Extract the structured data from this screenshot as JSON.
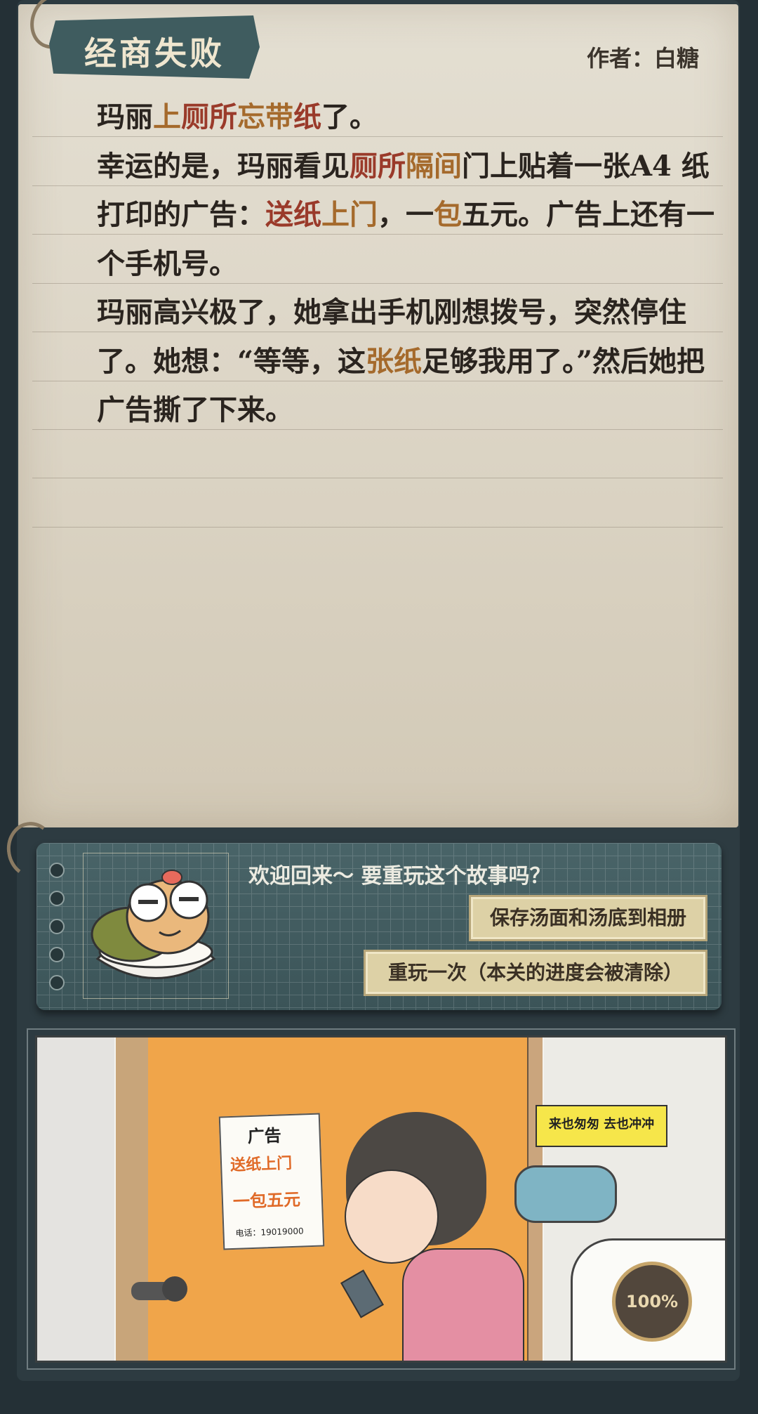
{
  "story": {
    "title": "经商失败",
    "author": "作者：白糖",
    "paragraph1": [
      {
        "text": "玛丽",
        "hl": ""
      },
      {
        "text": "上",
        "hl": "hl-brown"
      },
      {
        "text": "厕所",
        "hl": "hl-red"
      },
      {
        "text": "忘带",
        "hl": "hl-brown"
      },
      {
        "text": "纸",
        "hl": "hl-red"
      },
      {
        "text": "了。",
        "hl": ""
      }
    ],
    "paragraph2": [
      {
        "text": "幸运的是，玛丽看见",
        "hl": ""
      },
      {
        "text": "厕所",
        "hl": "hl-red"
      },
      {
        "text": "隔间",
        "hl": "hl-brown"
      },
      {
        "text": "门上贴着一张A4 纸打印的广告：",
        "hl": ""
      },
      {
        "text": "送纸",
        "hl": "hl-red"
      },
      {
        "text": "上门",
        "hl": "hl-brown"
      },
      {
        "text": "，一",
        "hl": ""
      },
      {
        "text": "包",
        "hl": "hl-brown"
      },
      {
        "text": "五元。广告上还有一个手机号。",
        "hl": ""
      }
    ],
    "paragraph3": [
      {
        "text": "玛丽高兴极了，她拿出手机刚想拨号，突然停住了。她想：“等等，这",
        "hl": ""
      },
      {
        "text": "张纸",
        "hl": "hl-brown"
      },
      {
        "text": "足够我用了。”然后她把广告撕了下来。",
        "hl": ""
      }
    ]
  },
  "dialog": {
    "welcome": "欢迎回来～ 要重玩这个故事吗？",
    "save_label": "保存汤面和汤底到相册",
    "replay_label": "重玩一次（本关的进度会被清除）"
  },
  "comic": {
    "poster_title": "广告",
    "poster_line1": "送纸上门",
    "poster_line2": "一包五元",
    "poster_phone": "电话：19019000",
    "sign_text": "来也匆匆 去也冲冲",
    "progress": "100%"
  },
  "colors": {
    "highlight_red": "#9a3a2a",
    "highlight_brown": "#a56a2c",
    "panel": "#3f5a5e",
    "button": "#ddd1a6"
  }
}
